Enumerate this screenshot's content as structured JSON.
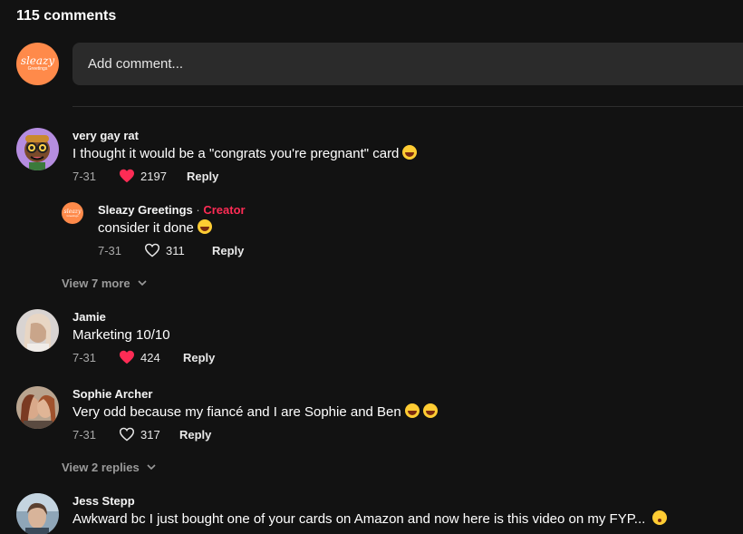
{
  "header": {
    "count_title": "115 comments"
  },
  "composer": {
    "placeholder": "Add comment...",
    "avatar_logo": "sleazy",
    "avatar_logo_sub": "Greetings"
  },
  "comments": [
    {
      "author": "very gay rat",
      "text": "I thought it would be a \"congrats you're pregnant\" card",
      "date": "7-31",
      "likes": "2197",
      "liked": true,
      "reply_label": "Reply"
    },
    {
      "author": "Sleazy Greetings",
      "separator": " · ",
      "badge": "Creator",
      "text": "consider it done",
      "date": "7-31",
      "likes": "311",
      "liked": false,
      "reply_label": "Reply"
    },
    {
      "author": "Jamie",
      "text": "Marketing 10/10",
      "date": "7-31",
      "likes": "424",
      "liked": true,
      "reply_label": "Reply"
    },
    {
      "author": "Sophie Archer",
      "text": "Very odd because my fiancé and I are Sophie and Ben",
      "date": "7-31",
      "likes": "317",
      "liked": false,
      "reply_label": "Reply"
    },
    {
      "author": "Jess Stepp",
      "text": "Awkward bc I just bought one of your cards on Amazon and now here is this video on my FYP...",
      "date": "",
      "likes": "",
      "liked": false,
      "reply_label": ""
    }
  ],
  "view_more_1": "View 7 more",
  "view_more_2": "View 2 replies",
  "colors": {
    "background": "#121212",
    "like_red": "#fe2c55",
    "creator_badge": "#fe2c55",
    "input_bg": "#2b2b2b",
    "brand_orange": "#ff8a4a"
  },
  "icons": {
    "like_filled": "heart-filled-icon",
    "like_outline": "heart-outline-icon",
    "expand": "chevron-down-icon",
    "emoji": "laughing-emoji-icon"
  }
}
